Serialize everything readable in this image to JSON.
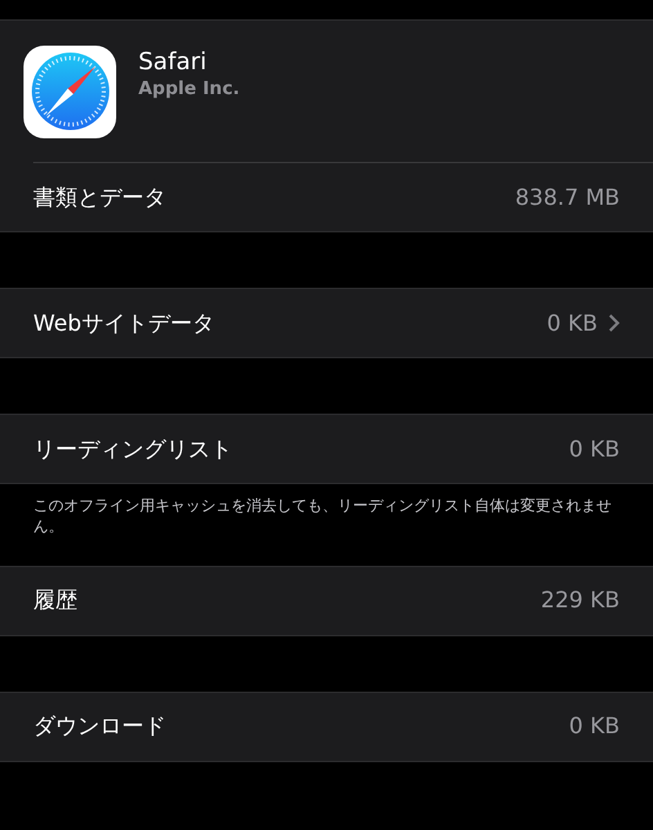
{
  "sections": [
    {
      "app": {
        "name": "Safari",
        "developer": "Apple Inc."
      },
      "rows": [
        {
          "label": "書類とデータ",
          "value": "838.7 MB",
          "chevron": false
        }
      ]
    },
    {
      "rows": [
        {
          "label": "Webサイトデータ",
          "value": "0 KB",
          "chevron": true
        }
      ]
    },
    {
      "rows": [
        {
          "label": "リーディングリスト",
          "value": "0 KB",
          "chevron": false
        }
      ],
      "footer": "このオフライン用キャッシュを消去しても、リーディングリスト自体は変更されません。"
    },
    {
      "rows": [
        {
          "label": "履歴",
          "value": "229 KB",
          "chevron": false
        }
      ]
    },
    {
      "rows": [
        {
          "label": "ダウンロード",
          "value": "0 KB",
          "chevron": false
        }
      ]
    }
  ]
}
